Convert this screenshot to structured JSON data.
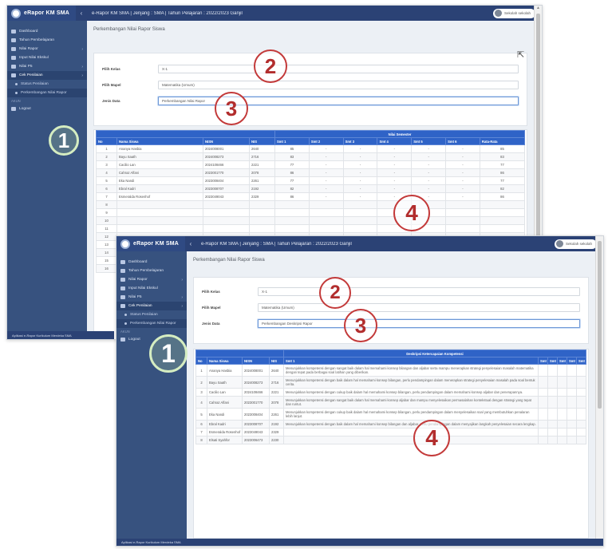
{
  "app": {
    "brand": "eRapor KM SMA",
    "topbar_title": "e-Rapor KM SMA | Jenjang : SMA | Tahun Pelajaran : 2022/2023 Ganjil",
    "user_name": "Sekolah sekolah",
    "collapse_glyph": "‹"
  },
  "sidebar": {
    "items": [
      {
        "label": "Dashboard"
      },
      {
        "label": "Tahun Pembelajaran"
      },
      {
        "label": "Nilai Rapor"
      },
      {
        "label": "Input Nilai Ekskul"
      },
      {
        "label": "Nilai P5"
      },
      {
        "label": "Cek Penilaian"
      }
    ],
    "sub_items": [
      {
        "label": "Status Penilaian"
      },
      {
        "label": "Perkembangan Nilai Rapor"
      }
    ],
    "section_header": "AKUN",
    "logout_label": "Logout",
    "chevron": "›"
  },
  "page": {
    "title": "Perkembangan Nilai Rapor Siswa"
  },
  "form": {
    "kelas_label": "Pilih Kelas",
    "kelas_value": "X-1",
    "mapel_label": "Pilih Mapel",
    "mapel_value": "Matematika (Umum)",
    "jenis_label": "Jenis Data",
    "jenis_value_back": "Perkembangan Nilai Rapor",
    "jenis_value_front": "Perkembangan Deskripsi Rapor"
  },
  "back_table": {
    "group_header": "Nilai Semester",
    "columns": [
      "No",
      "Nama Siswa",
      "NISN",
      "NIS",
      "Smt 1",
      "Smt 2",
      "Smt 3",
      "Smt 4",
      "Smt 5",
      "Smt 6",
      "Rata-Rata"
    ],
    "rows": [
      [
        "1",
        "Ananya Hasbia",
        "2024008001",
        "2640",
        "85",
        "-",
        "-",
        "-",
        "-",
        "-",
        "85"
      ],
      [
        "2",
        "Bayu Saath",
        "2024008273",
        "2716",
        "83",
        "-",
        "-",
        "-",
        "-",
        "-",
        "83"
      ],
      [
        "3",
        "Cacilio Lan",
        "2024108466",
        "2221",
        "77",
        "-",
        "-",
        "-",
        "-",
        "-",
        "77"
      ],
      [
        "4",
        "Cahraz Alfani",
        "2023001770",
        "2078",
        "86",
        "-",
        "-",
        "-",
        "-",
        "-",
        "86"
      ],
      [
        "5",
        "Eka Nandi",
        "2023008404",
        "2261",
        "77",
        "-",
        "-",
        "-",
        "-",
        "-",
        "77"
      ],
      [
        "6",
        "Ebral Kadri",
        "2023008707",
        "2192",
        "82",
        "-",
        "-",
        "-",
        "-",
        "-",
        "82"
      ],
      [
        "7",
        "Esmeralda Rosenhof",
        "2023049043",
        "2329",
        "86",
        "-",
        "-",
        "-",
        "-",
        "-",
        "86"
      ],
      [
        "8",
        "",
        "",
        "",
        "",
        "",
        "",
        "",
        "",
        "",
        ""
      ],
      [
        "9",
        "",
        "",
        "",
        "",
        "",
        "",
        "",
        "",
        "",
        ""
      ],
      [
        "10",
        "",
        "",
        "",
        "",
        "",
        "",
        "",
        "",
        "",
        ""
      ],
      [
        "11",
        "",
        "",
        "",
        "",
        "",
        "",
        "",
        "",
        "",
        ""
      ],
      [
        "12",
        "",
        "",
        "",
        "",
        "",
        "",
        "",
        "",
        "",
        ""
      ],
      [
        "13",
        "",
        "",
        "",
        "",
        "",
        "",
        "",
        "",
        "",
        ""
      ],
      [
        "14",
        "",
        "",
        "",
        "",
        "",
        "",
        "",
        "",
        "",
        ""
      ],
      [
        "15",
        "",
        "",
        "",
        "",
        "",
        "",
        "",
        "",
        "",
        ""
      ],
      [
        "16",
        "",
        "",
        "",
        "",
        "",
        "",
        "",
        "",
        "",
        ""
      ]
    ]
  },
  "front_table": {
    "group_header": "Deskripsi Ketercapaian Kompetensi",
    "columns": [
      "No",
      "Nama Siswa",
      "NISN",
      "NIS",
      "Smt 1",
      "Smt 2",
      "Smt 3",
      "Smt 4",
      "Smt 5",
      "Smt 6"
    ],
    "rows": [
      [
        "1",
        "Ananya Hasbia",
        "2024008001",
        "2640",
        "Menunjukkan kompetensi dengan sangat baik dalam hal memahami konsep bilangan dan aljabar serta mampu menerapkan strategi penyelesaian masalah matematika dengan tepat pada berbagai soal latihan yang diberikan."
      ],
      [
        "2",
        "Bayu Saath",
        "2024008273",
        "2716",
        "Menunjukkan kompetensi dengan baik dalam hal memahami konsep bilangan, perlu pendampingan dalam menerapkan strategi penyelesaian masalah pada soal bentuk cerita."
      ],
      [
        "3",
        "Cacilio Lan",
        "2024108466",
        "2221",
        "Menunjukkan kompetensi dengan cukup baik dalam hal memahami konsep bilangan, perlu pendampingan dalam memahami konsep aljabar dan penerapannya."
      ],
      [
        "4",
        "Cahraz Alfani",
        "2023001770",
        "2078",
        "Menunjukkan kompetensi dengan sangat baik dalam hal memahami konsep aljabar dan mampu menyelesaikan permasalahan kontekstual dengan strategi yang tepat dan runtut."
      ],
      [
        "5",
        "Eka Nandi",
        "2023008404",
        "2261",
        "Menunjukkan kompetensi dengan cukup baik dalam hal memahami konsep bilangan, perlu pendampingan dalam menyelesaikan soal yang membutuhkan penalaran lebih lanjut."
      ],
      [
        "6",
        "Ebral Kadri",
        "2023008707",
        "2192",
        "Menunjukkan kompetensi dengan baik dalam hal memahami konsep bilangan dan aljabar, perlu pendampingan dalam menyajikan langkah penyelesaian secara lengkap."
      ],
      [
        "7",
        "Esmeralda Rosenhof",
        "2023049043",
        "2329",
        ""
      ],
      [
        "8",
        "Elsati Syahfor",
        "2023006473",
        "2230",
        ""
      ]
    ]
  },
  "footer": {
    "text": "Aplikasi e-Rapor Kurikulum Merdeka SMA"
  },
  "callouts": {
    "one": "1",
    "two": "2",
    "three": "3",
    "four": "4"
  },
  "colors": {
    "sidebar": "#37527f",
    "topbar": "#2b4275",
    "table_header": "#2f63c7",
    "callout_red": "#c33a3a",
    "callout_green": "#d5edc1"
  }
}
